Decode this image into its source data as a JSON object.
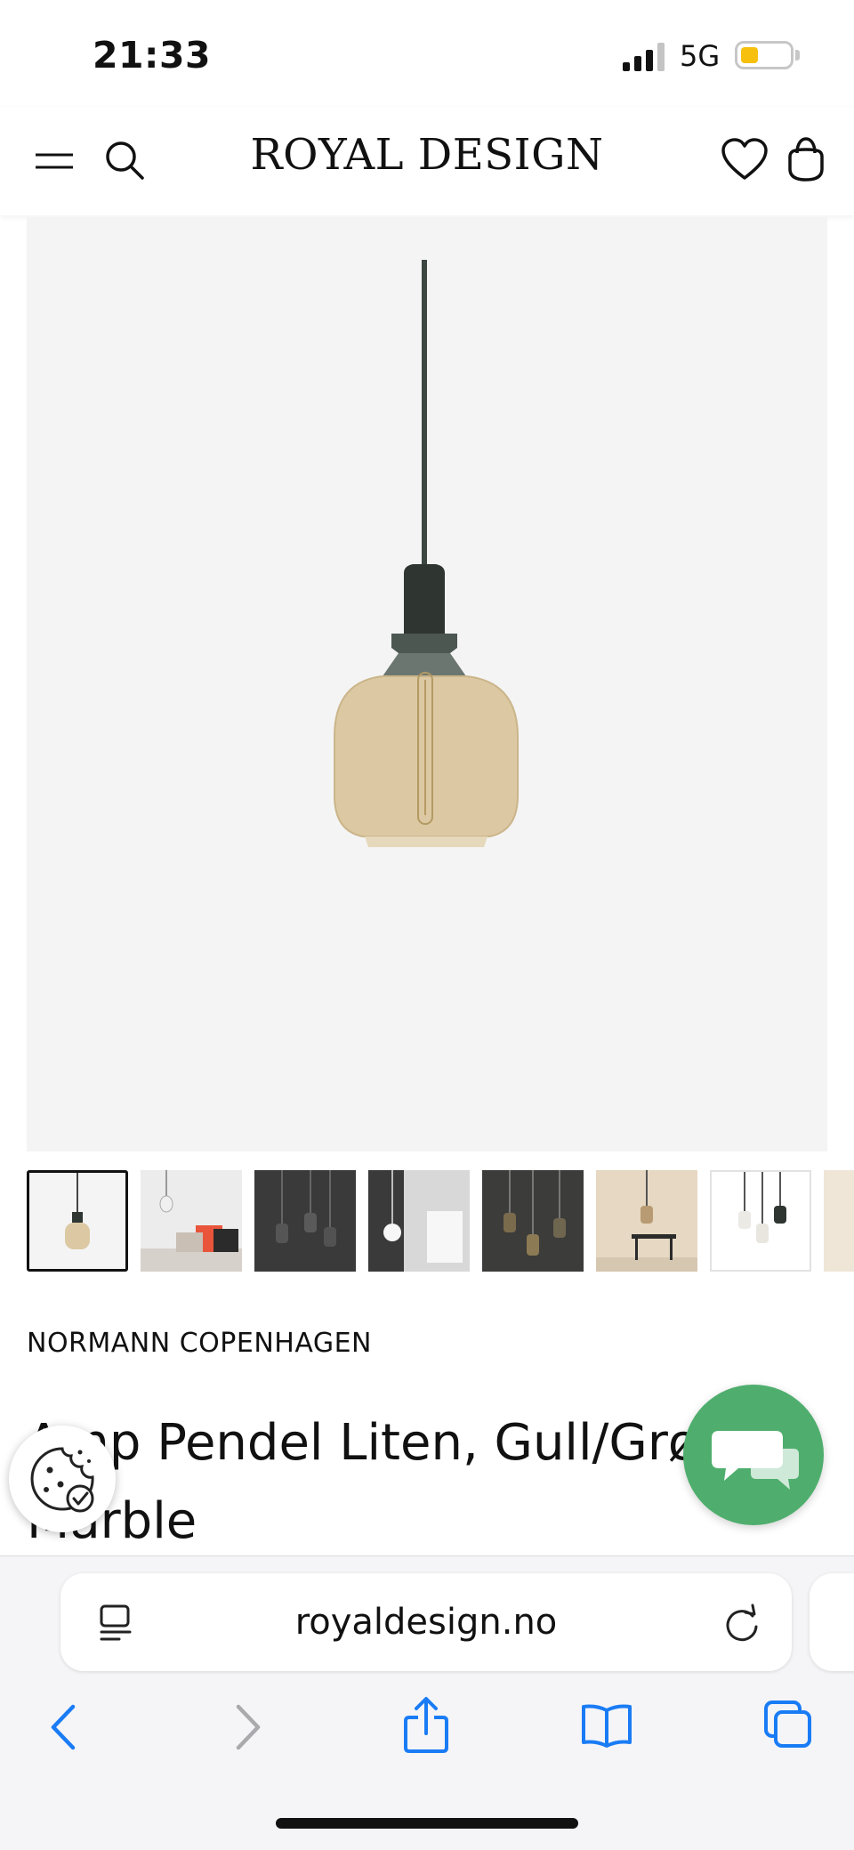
{
  "status_bar": {
    "time": "21:33",
    "network": "5G",
    "battery_level": 0.35,
    "signal_bars_active": 3,
    "signal_bars_total": 4
  },
  "header": {
    "logo": "ROYAL DESIGN",
    "icons": [
      "menu-icon",
      "search-icon",
      "heart-icon",
      "bag-icon"
    ]
  },
  "product": {
    "brand": "NORMANN COPENHAGEN",
    "title": "Amp Pendel Liten, Gull/Grønn Marble",
    "thumbnails_count": 8,
    "active_thumbnail": 1
  },
  "browser": {
    "url": "royaldesign.no"
  },
  "colors": {
    "accent_chat": "#4fae6d",
    "safari_blue": "#1a7cf5",
    "battery": "#f6c00c"
  }
}
